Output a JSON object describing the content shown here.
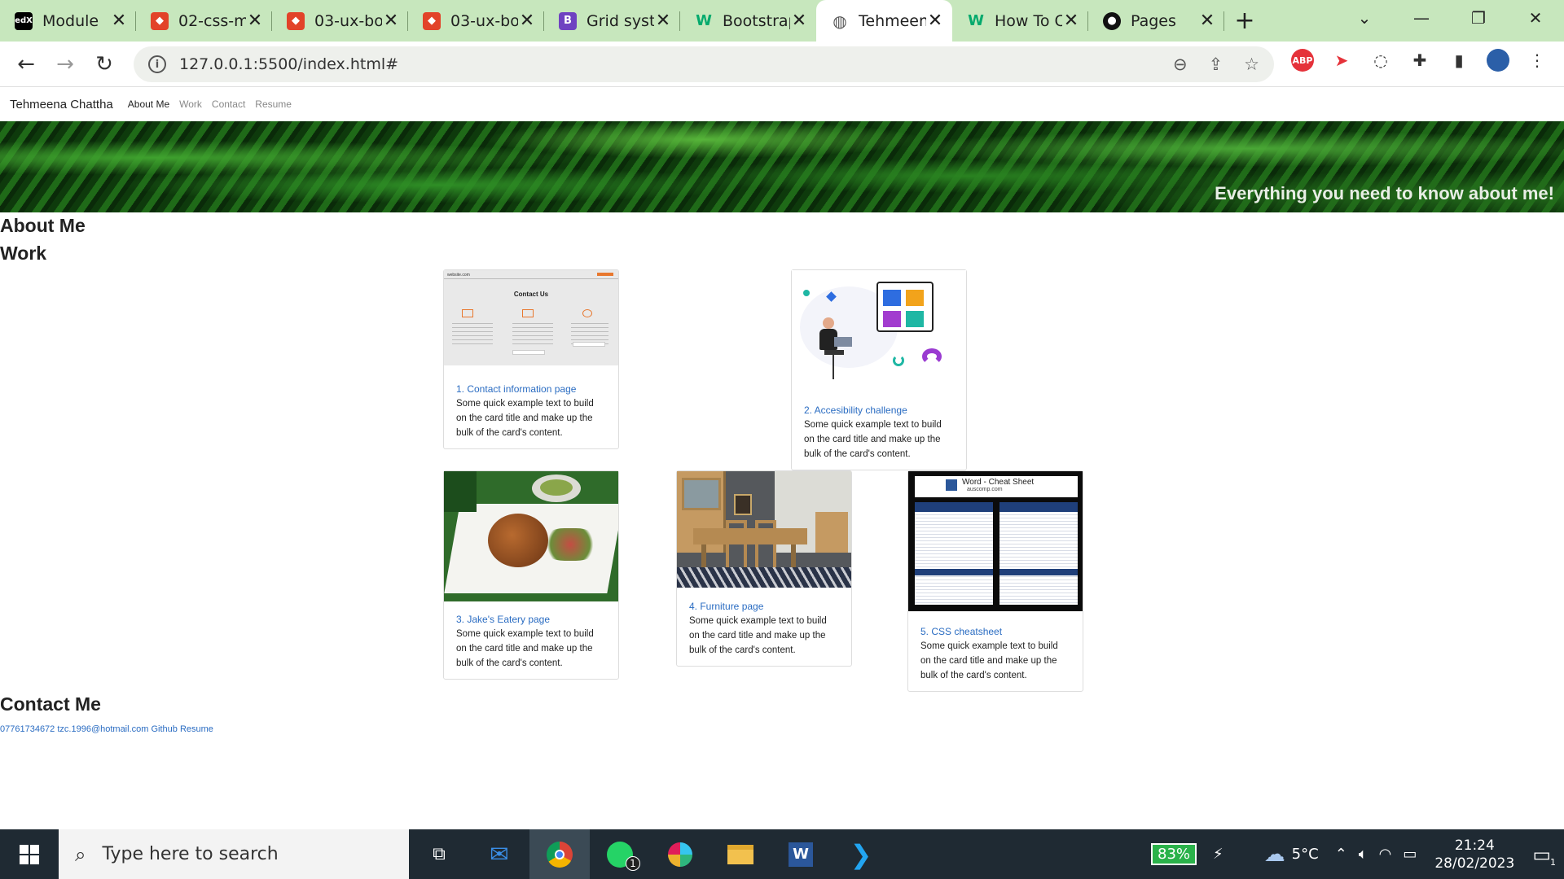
{
  "browser": {
    "tabs": [
      {
        "label": "Module",
        "icon": "edx-icon",
        "color": "#000000"
      },
      {
        "label": "02-css-m",
        "icon": "gitlab-icon",
        "color": "#e24329"
      },
      {
        "label": "03-ux-bo",
        "icon": "gitlab-icon",
        "color": "#e24329"
      },
      {
        "label": "03-ux-bo",
        "icon": "gitlab-icon",
        "color": "#e24329"
      },
      {
        "label": "Grid syst",
        "icon": "bootstrap-icon",
        "color": "#6f42c1"
      },
      {
        "label": "Bootstrap",
        "icon": "w3schools-icon",
        "color": "#04aa6d"
      },
      {
        "label": "Tehmeen",
        "icon": "globe-icon",
        "color": "#555555"
      },
      {
        "label": "How To C",
        "icon": "w3schools-icon",
        "color": "#04aa6d"
      },
      {
        "label": "Pages",
        "icon": "github-icon",
        "color": "#111111"
      }
    ],
    "url": "127.0.0.1:5500/index.html#",
    "extensions": {
      "abp": "ABP"
    }
  },
  "site": {
    "brand": "Tehmeena Chattha",
    "nav": [
      "About Me",
      "Work",
      "Contact",
      "Resume"
    ],
    "hero_text": "Everything you need to know about me!",
    "about_heading": "About Me",
    "work_heading": "Work",
    "contact_heading": "Contact Me",
    "card_text": "Some quick example text to build on the card title and make up the bulk of the card's content.",
    "cards": [
      {
        "title": "1. Contact information page",
        "thumb_heading": "Contact Us",
        "thumb_site": "website.com"
      },
      {
        "title": "2. Accesibility challenge"
      },
      {
        "title": "3. Jake's Eatery page"
      },
      {
        "title": "4. Furniture page"
      },
      {
        "title": "5. CSS cheatsheet",
        "thumb_heading": "Word - Cheat Sheet",
        "thumb_site": "auscomp.com"
      }
    ],
    "contact": {
      "phone": "07761734672",
      "email": "tzc.1996@hotmail.com",
      "github": "Github",
      "resume": "Resume"
    }
  },
  "taskbar": {
    "search_placeholder": "Type here to search",
    "battery": "83%",
    "temperature": "5°C",
    "time": "21:24",
    "date": "28/02/2023",
    "whatsapp_badge": "1",
    "notification_badge": "1"
  }
}
